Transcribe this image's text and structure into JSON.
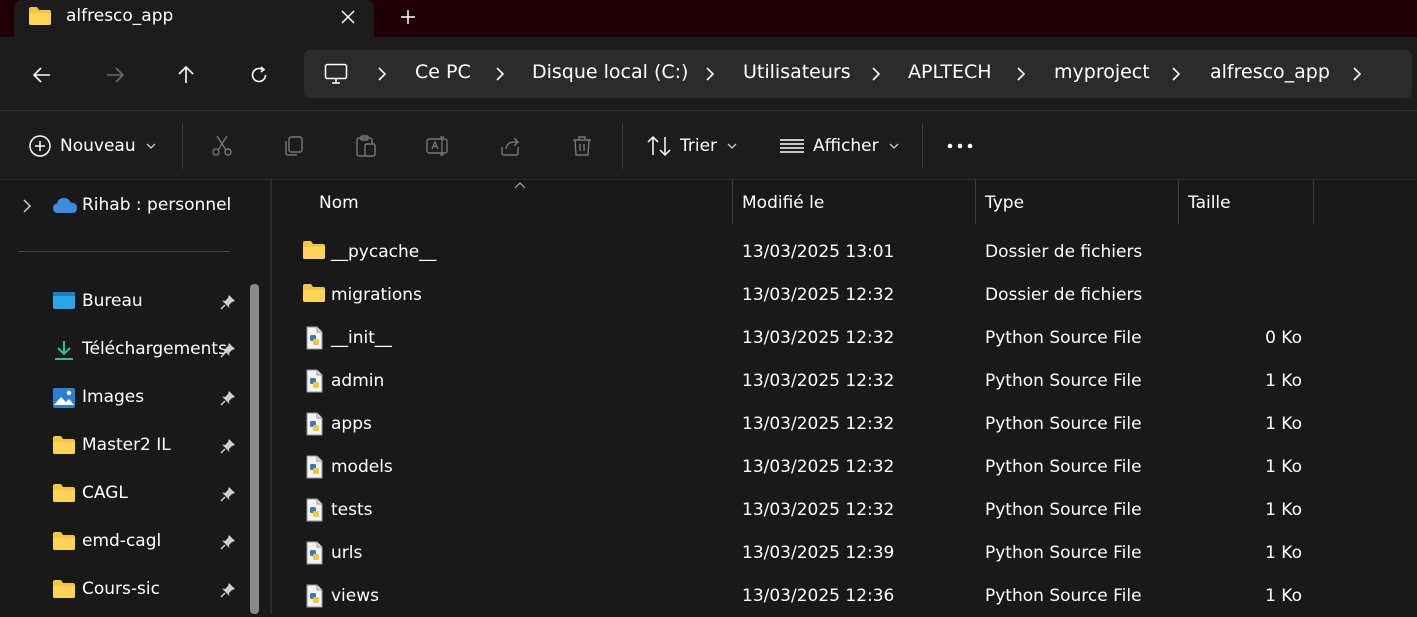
{
  "window": {
    "tab_title": "alfresco_app",
    "tab_icon": "folder-icon",
    "new_tab_glyph": "+",
    "close_glyph": "✕"
  },
  "navigation": {
    "back": "arrow-left-icon",
    "forward": "arrow-right-icon",
    "up": "arrow-up-icon",
    "refresh": "refresh-icon"
  },
  "breadcrumb": [
    "Ce PC",
    "Disque local (C:)",
    "Utilisateurs",
    "APLTECH",
    "myproject",
    "alfresco_app"
  ],
  "toolbar": {
    "new_label": "Nouveau",
    "sort_label": "Trier",
    "view_label": "Afficher",
    "more_glyph": "•••"
  },
  "sidebar": {
    "cloud_label": "Rihab : personnel",
    "items": [
      {
        "label": "Bureau",
        "icon": "desktop-icon"
      },
      {
        "label": "Téléchargements",
        "icon": "download-icon"
      },
      {
        "label": "Images",
        "icon": "pictures-icon"
      },
      {
        "label": "Master2 IL",
        "icon": "folder-icon"
      },
      {
        "label": "CAGL",
        "icon": "folder-icon"
      },
      {
        "label": "emd-cagl",
        "icon": "folder-icon"
      },
      {
        "label": "Cours-sic",
        "icon": "folder-icon"
      }
    ]
  },
  "columns": {
    "name": "Nom",
    "modified": "Modifié le",
    "type": "Type",
    "size": "Taille"
  },
  "files": [
    {
      "name": "__pycache__",
      "modified": "13/03/2025 13:01",
      "type": "Dossier de fichiers",
      "size": "",
      "kind": "folder"
    },
    {
      "name": "migrations",
      "modified": "13/03/2025 12:32",
      "type": "Dossier de fichiers",
      "size": "",
      "kind": "folder"
    },
    {
      "name": "__init__",
      "modified": "13/03/2025 12:32",
      "type": "Python Source File",
      "size": "0 Ko",
      "kind": "python"
    },
    {
      "name": "admin",
      "modified": "13/03/2025 12:32",
      "type": "Python Source File",
      "size": "1 Ko",
      "kind": "python"
    },
    {
      "name": "apps",
      "modified": "13/03/2025 12:32",
      "type": "Python Source File",
      "size": "1 Ko",
      "kind": "python"
    },
    {
      "name": "models",
      "modified": "13/03/2025 12:32",
      "type": "Python Source File",
      "size": "1 Ko",
      "kind": "python"
    },
    {
      "name": "tests",
      "modified": "13/03/2025 12:32",
      "type": "Python Source File",
      "size": "1 Ko",
      "kind": "python"
    },
    {
      "name": "urls",
      "modified": "13/03/2025 12:39",
      "type": "Python Source File",
      "size": "1 Ko",
      "kind": "python"
    },
    {
      "name": "views",
      "modified": "13/03/2025 12:36",
      "type": "Python Source File",
      "size": "1 Ko",
      "kind": "python"
    }
  ],
  "colors": {
    "titlebar": "#200006",
    "background": "#191919",
    "folder": "#f4c542",
    "accent": "#3d8be4"
  }
}
